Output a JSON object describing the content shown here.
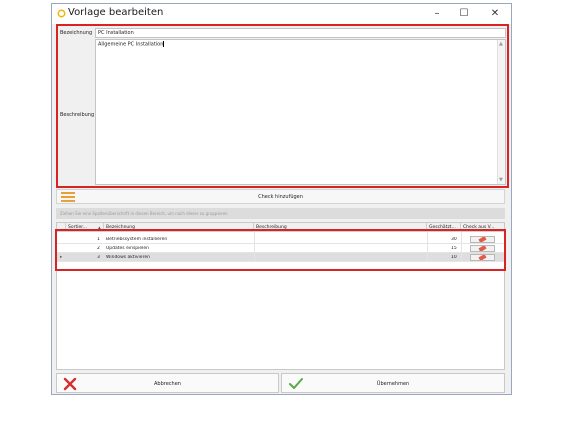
{
  "window": {
    "title": "Vorlage bearbeiten",
    "minimize": "–",
    "maximize": "☐",
    "close": "✕"
  },
  "form": {
    "bezeichnung_label": "Bezeichnung",
    "bezeichnung_value": "PC Installation",
    "beschreibung_label": "Beschreibung",
    "beschreibung_value": "Allgemeine PC Installation"
  },
  "check_bar": {
    "label": "Check hinzufügen"
  },
  "group_panel": {
    "text": "Ziehen Sie eine Spaltenüberschrift in diesen Bereich, um nach dieser zu gruppieren"
  },
  "grid": {
    "columns": [
      "Sortier...",
      "Bezeichnung",
      "Beschreibung",
      "Geschätzt...",
      "Check aus V..."
    ],
    "sort_indicator": "▲",
    "rows": [
      {
        "sort": "1",
        "name": "Betriebssystem installieren",
        "desc": "",
        "est": "30",
        "selected": false
      },
      {
        "sort": "2",
        "name": "Updates einspielen",
        "desc": "",
        "est": "15",
        "selected": false
      },
      {
        "sort": "3",
        "name": "Windows aktivieren",
        "desc": "",
        "est": "10",
        "selected": true
      }
    ],
    "row_indicator": "▸"
  },
  "buttons": {
    "cancel": "Abbrechen",
    "accept": "Übernehmen"
  },
  "colors": {
    "highlight": "#d92222",
    "cancel_icon": "#d32f2f",
    "accept_icon": "#5aa84a",
    "title_icon": "#f2b600"
  }
}
